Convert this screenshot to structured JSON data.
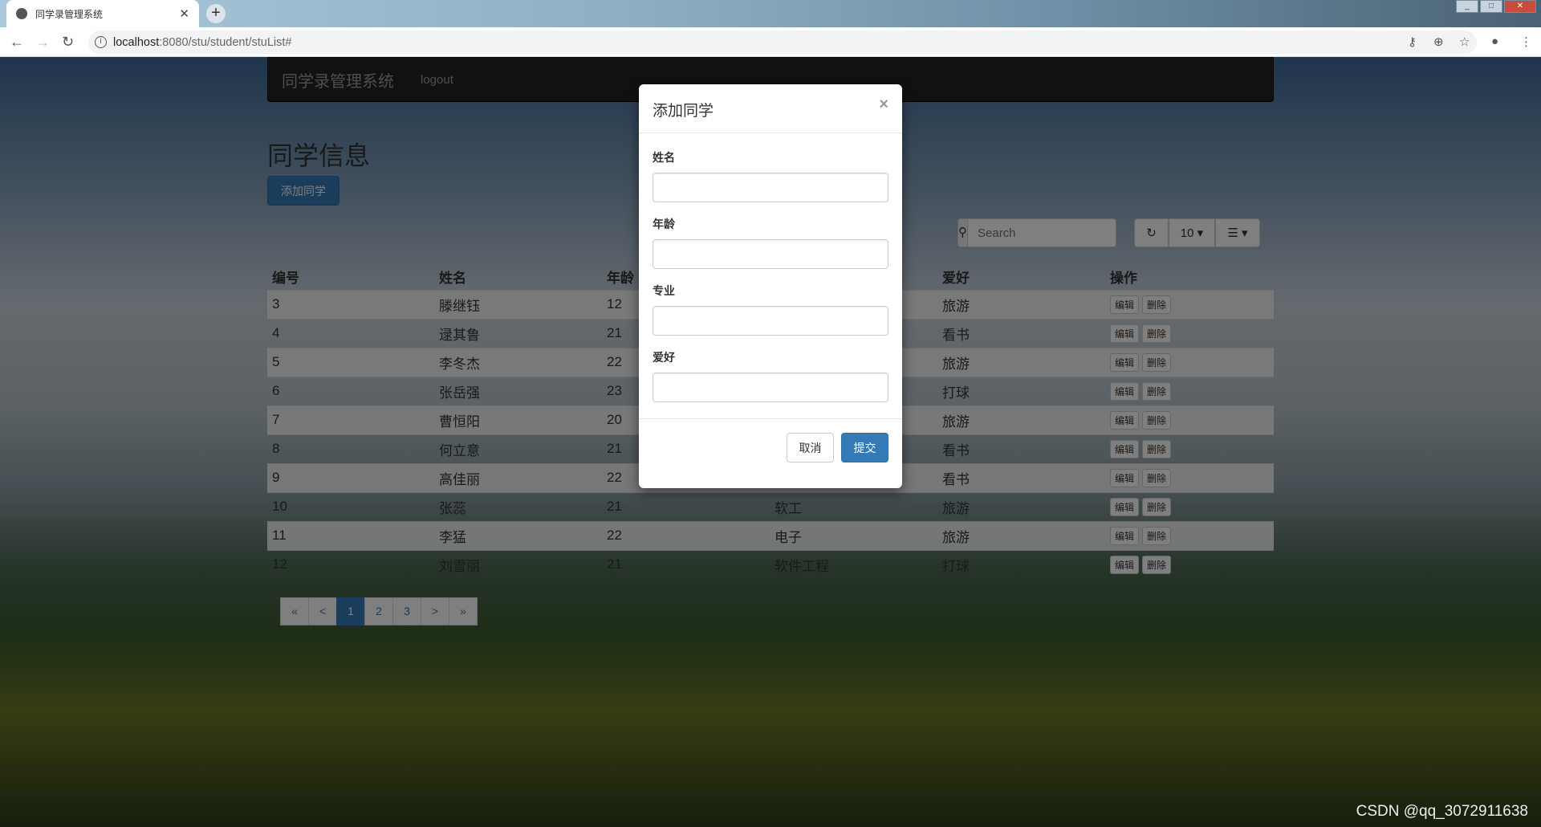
{
  "browser": {
    "tab_title": "同学录管理系统",
    "url_host": "localhost",
    "url_path": ":8080/stu/student/stuList#"
  },
  "navbar": {
    "brand": "同学录管理系统",
    "logout": "logout"
  },
  "page": {
    "title": "同学信息",
    "add_button": "添加同学"
  },
  "toolbar": {
    "search_placeholder": "Search",
    "page_size": "10"
  },
  "table": {
    "headers": [
      "编号",
      "姓名",
      "年龄",
      "专业",
      "爱好",
      "操作"
    ],
    "rows": [
      {
        "id": "3",
        "name": "滕继钰",
        "age": "12",
        "major": "",
        "hobby": "旅游"
      },
      {
        "id": "4",
        "name": "逯其鲁",
        "age": "21",
        "major": "",
        "hobby": "看书"
      },
      {
        "id": "5",
        "name": "李冬杰",
        "age": "22",
        "major": "",
        "hobby": "旅游"
      },
      {
        "id": "6",
        "name": "张岳强",
        "age": "23",
        "major": "",
        "hobby": "打球"
      },
      {
        "id": "7",
        "name": "曹恒阳",
        "age": "20",
        "major": "",
        "hobby": "旅游"
      },
      {
        "id": "8",
        "name": "何立意",
        "age": "21",
        "major": "",
        "hobby": "看书"
      },
      {
        "id": "9",
        "name": "高佳丽",
        "age": "22",
        "major": "",
        "hobby": "看书"
      },
      {
        "id": "10",
        "name": "张蕊",
        "age": "21",
        "major": "软工",
        "hobby": "旅游"
      },
      {
        "id": "11",
        "name": "李猛",
        "age": "22",
        "major": "电子",
        "hobby": "旅游"
      },
      {
        "id": "12",
        "name": "刘雪丽",
        "age": "21",
        "major": "软件工程",
        "hobby": "打球"
      }
    ],
    "edit": "编辑",
    "delete": "删除"
  },
  "pagination": [
    "«",
    "<",
    "1",
    "2",
    "3",
    ">",
    "»"
  ],
  "modal": {
    "title": "添加同学",
    "close": "×",
    "fields": [
      "姓名",
      "年龄",
      "专业",
      "爱好"
    ],
    "cancel": "取消",
    "submit": "提交"
  },
  "watermark": "CSDN @qq_3072911638",
  "colors": {
    "primary": "#337ab7",
    "navbar": "#222222"
  }
}
